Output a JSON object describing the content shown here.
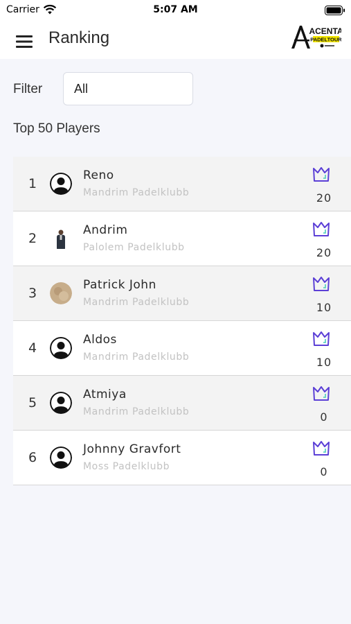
{
  "status_bar": {
    "carrier": "Carrier",
    "time": "5:07 AM"
  },
  "header": {
    "title": "Ranking",
    "logo_text_top": "ACENTA",
    "logo_text_bottom": "PADELTOUR"
  },
  "filter": {
    "label": "Filter",
    "value": "All"
  },
  "section_title": "Top 50 Players",
  "colors": {
    "accent": "#5b3fd6",
    "crown_check": "#5fd3c0",
    "row_alt": "#f3f3f3"
  },
  "players": [
    {
      "rank": "1",
      "name": "Reno",
      "club": "Mandrim Padelklubb",
      "points": "20",
      "avatar": "default-user-icon"
    },
    {
      "rank": "2",
      "name": "Andrim",
      "club": "Palolem Padelklubb",
      "points": "20",
      "avatar": "photo"
    },
    {
      "rank": "3",
      "name": "Patrick John",
      "club": "Mandrim Padelklubb",
      "points": "10",
      "avatar": "photo"
    },
    {
      "rank": "4",
      "name": "Aldos",
      "club": "Mandrim Padelklubb",
      "points": "10",
      "avatar": "default-user-icon"
    },
    {
      "rank": "5",
      "name": "Atmiya",
      "club": "Mandrim Padelklubb",
      "points": "0",
      "avatar": "default-user-icon"
    },
    {
      "rank": "6",
      "name": "Johnny Gravfort",
      "club": "Moss Padelklubb",
      "points": "0",
      "avatar": "default-user-icon"
    }
  ]
}
